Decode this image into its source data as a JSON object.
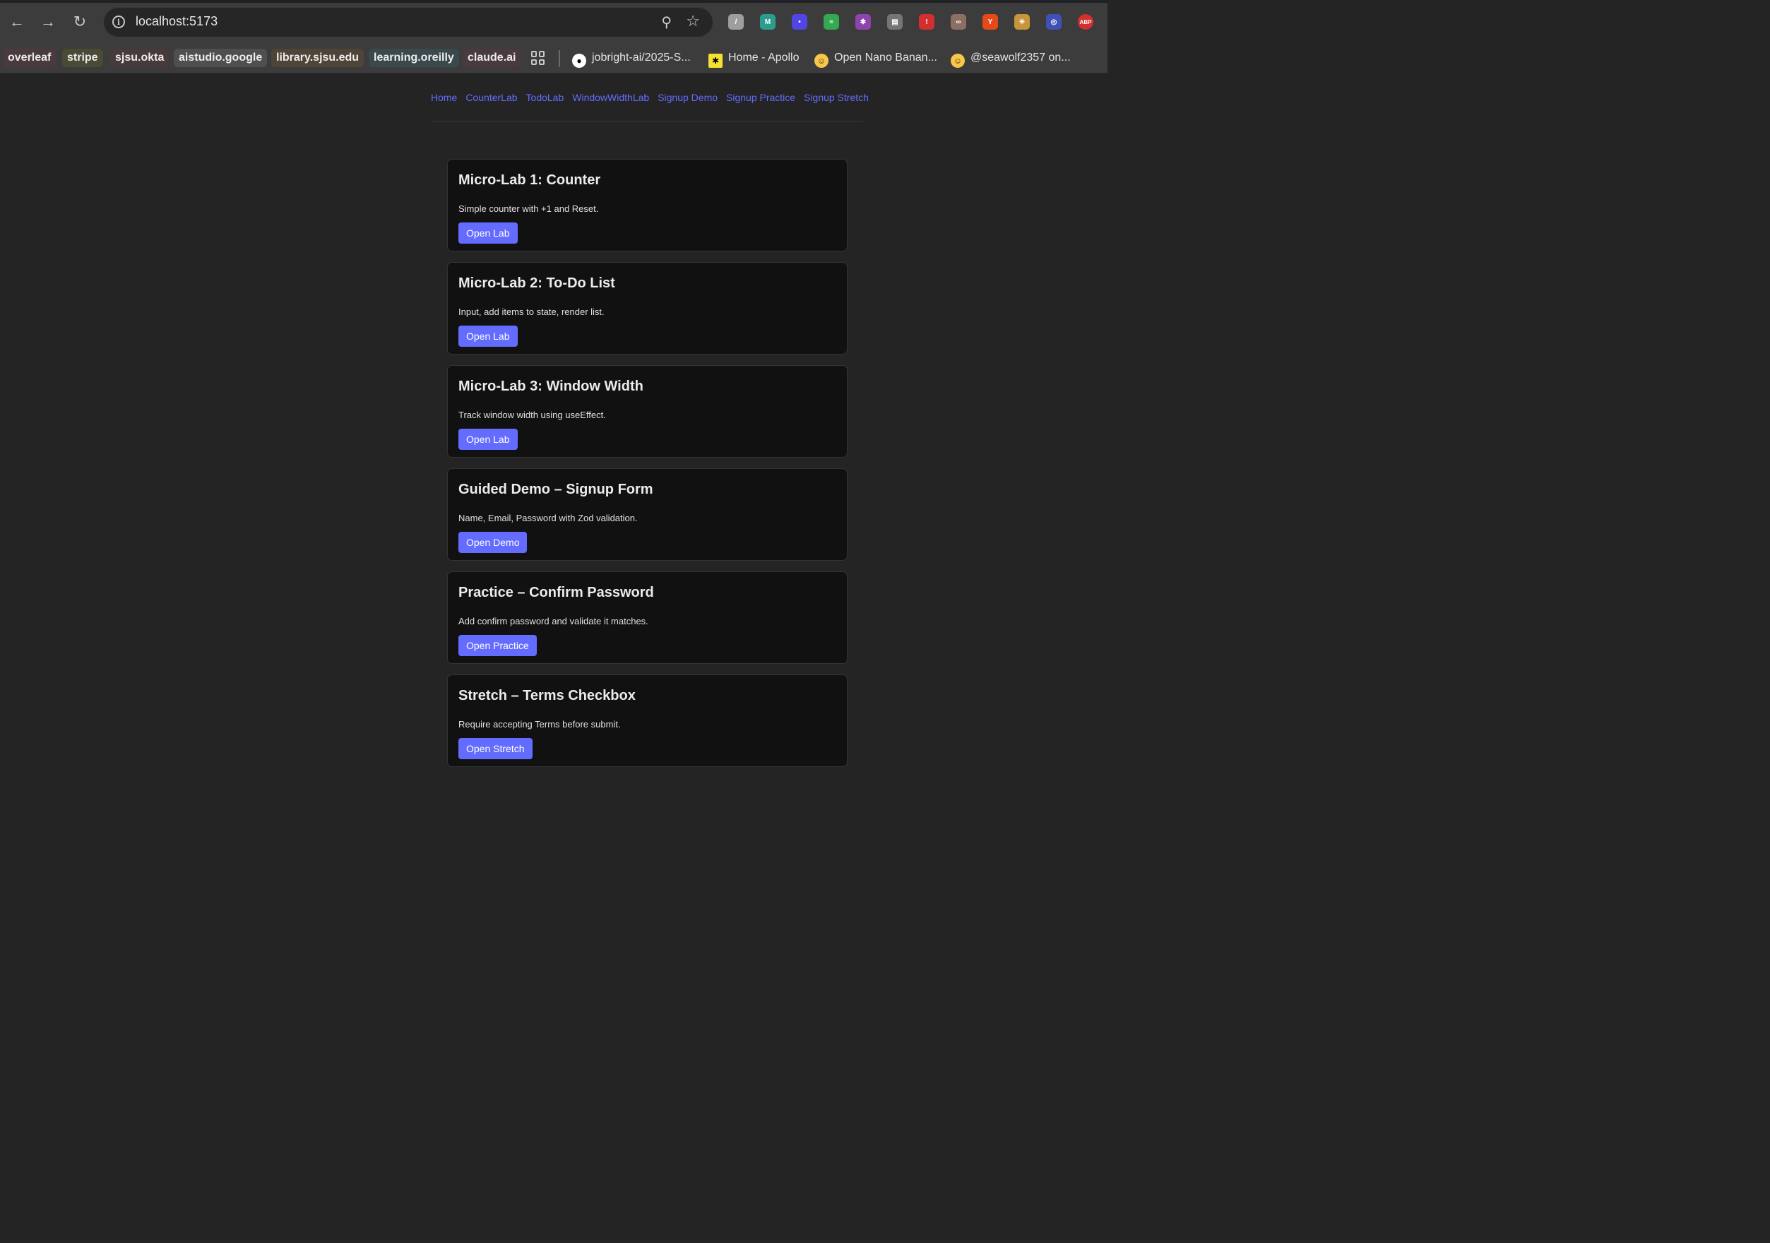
{
  "browser": {
    "url": "localhost:5173",
    "back_icon": "←",
    "forward_icon": "→",
    "reload_icon": "↻",
    "info_icon": "i",
    "zoom_icon": "⚲",
    "star_icon": "☆",
    "extensions": [
      {
        "name": "notes-extension-icon",
        "glyph": "/",
        "color": "#9e9e9e"
      },
      {
        "name": "copilot-extension-icon",
        "glyph": "M",
        "color": "#2a9d8f"
      },
      {
        "name": "face-extension-icon",
        "glyph": "•",
        "color": "#4f46e5"
      },
      {
        "name": "green-extension-icon",
        "glyph": "≡",
        "color": "#34a853"
      },
      {
        "name": "brain-extension-icon",
        "glyph": "✱",
        "color": "#8e44ad"
      },
      {
        "name": "reader-extension-icon",
        "glyph": "▤",
        "color": "#757575"
      },
      {
        "name": "red-flag-extension-icon",
        "glyph": "!",
        "color": "#d32f2f"
      },
      {
        "name": "glasses-extension-icon",
        "glyph": "∞",
        "color": "#8d6e63"
      },
      {
        "name": "translate-extension-icon",
        "glyph": "Y",
        "color": "#e64a19"
      },
      {
        "name": "sun-extension-icon",
        "glyph": "✳",
        "color": "#c7953a"
      },
      {
        "name": "target-extension-icon",
        "glyph": "◎",
        "color": "#3f51b5"
      },
      {
        "name": "adblock-extension-icon",
        "glyph": "ABP",
        "color": "#d32f2f"
      }
    ]
  },
  "bookmarks": {
    "chips": [
      {
        "label": "overleaf",
        "bg": "#4a3a3e"
      },
      {
        "label": "stripe",
        "bg": "#4a4a35"
      },
      {
        "label": "sjsu.okta",
        "bg": "#48393a"
      },
      {
        "label": "aistudio.google",
        "bg": "#4f4f4f"
      },
      {
        "label": "library.sjsu.edu",
        "bg": "#4f4537"
      },
      {
        "label": "learning.oreilly",
        "bg": "#3a4a4c"
      },
      {
        "label": "claude.ai",
        "bg": "#4a3a40"
      }
    ],
    "links": [
      {
        "label": "jobright-ai/2025-S...",
        "icon": "github-icon"
      },
      {
        "label": "Home - Apollo",
        "icon": "apollo-icon"
      },
      {
        "label": "Open Nano Banan...",
        "icon": "hugging-face-icon"
      },
      {
        "label": "@seawolf2357 on...",
        "icon": "hugging-face-icon"
      }
    ]
  },
  "nav": {
    "links": [
      "Home",
      "CounterLab",
      "TodoLab",
      "WindowWidthLab",
      "Signup Demo",
      "Signup Practice",
      "Signup Stretch"
    ]
  },
  "cards": [
    {
      "title": "Micro-Lab 1: Counter",
      "description": "Simple counter with +1 and Reset.",
      "button": "Open Lab"
    },
    {
      "title": "Micro-Lab 2: To-Do List",
      "description": "Input, add items to state, render list.",
      "button": "Open Lab"
    },
    {
      "title": "Micro-Lab 3: Window Width",
      "description": "Track window width using useEffect.",
      "button": "Open Lab"
    },
    {
      "title": "Guided Demo – Signup Form",
      "description": "Name, Email, Password with Zod validation.",
      "button": "Open Demo"
    },
    {
      "title": "Practice – Confirm Password",
      "description": "Add confirm password and validate it matches.",
      "button": "Open Practice"
    },
    {
      "title": "Stretch – Terms Checkbox",
      "description": "Require accepting Terms before submit.",
      "button": "Open Stretch"
    }
  ],
  "colors": {
    "accent": "#646cff",
    "page_background": "#242424",
    "card_background": "#111111"
  }
}
